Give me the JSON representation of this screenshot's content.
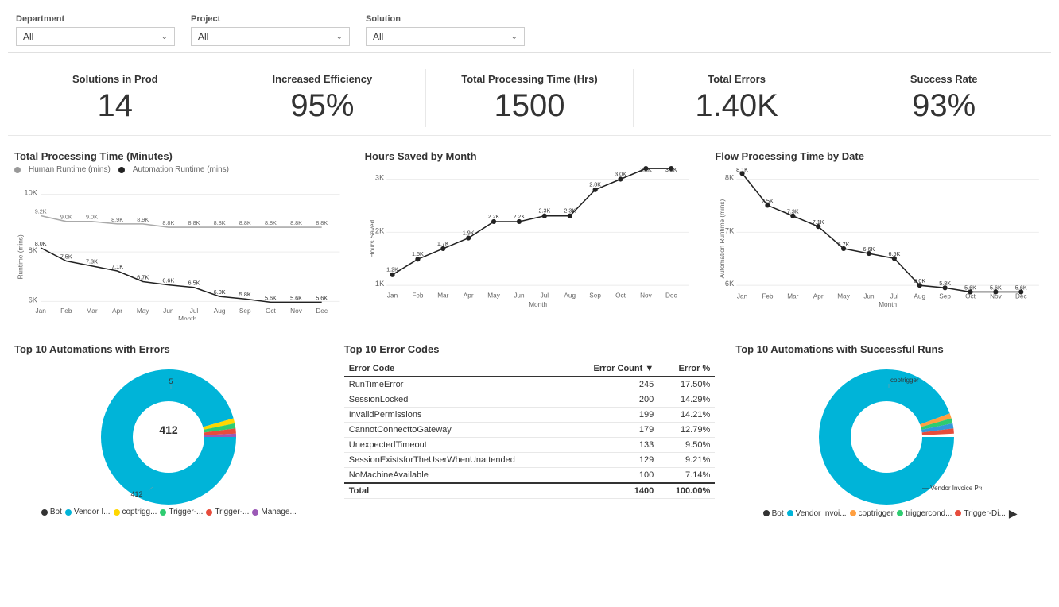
{
  "filters": {
    "department": {
      "label": "Department",
      "value": "All"
    },
    "project": {
      "label": "Project",
      "value": "All"
    },
    "solution": {
      "label": "Solution",
      "value": "All"
    }
  },
  "kpis": [
    {
      "label": "Solutions in Prod",
      "value": "14"
    },
    {
      "label": "Increased Efficiency",
      "value": "95%"
    },
    {
      "label": "Total Processing Time (Hrs)",
      "value": "1500"
    },
    {
      "label": "Total Errors",
      "value": "1.40K"
    },
    {
      "label": "Success Rate",
      "value": "93%"
    }
  ],
  "charts": {
    "processing_time": {
      "title": "Total Processing Time (Minutes)",
      "legend_human": "Human Runtime (mins)",
      "legend_auto": "Automation Runtime (mins)",
      "months": [
        "Jan",
        "Feb",
        "Mar",
        "Apr",
        "May",
        "Jun",
        "Jul",
        "Aug",
        "Sep",
        "Oct",
        "Nov",
        "Dec"
      ],
      "human": [
        9200,
        9000,
        9000,
        8900,
        8900,
        8800,
        8800,
        8800,
        8800,
        8800,
        8800,
        8800
      ],
      "automation": [
        8000,
        7500,
        7300,
        7100,
        6700,
        6600,
        6500,
        6000,
        5800,
        5600,
        5600,
        5600
      ]
    },
    "hours_saved": {
      "title": "Hours Saved by Month",
      "months": [
        "Jan",
        "Feb",
        "Mar",
        "Apr",
        "May",
        "Jun",
        "Jul",
        "Aug",
        "Sep",
        "Oct",
        "Nov",
        "Dec"
      ],
      "values": [
        1200,
        1500,
        1700,
        1900,
        2200,
        2200,
        2300,
        2300,
        2800,
        3000,
        3200,
        3200
      ]
    },
    "flow_processing": {
      "title": "Flow Processing Time by Date",
      "months": [
        "Jan",
        "Feb",
        "Mar",
        "Apr",
        "May",
        "Jun",
        "Jul",
        "Aug",
        "Sep",
        "Oct",
        "Nov",
        "Dec"
      ],
      "values": [
        8100,
        7500,
        7300,
        7100,
        6700,
        6600,
        6500,
        6000,
        5800,
        5600,
        5600,
        5600
      ]
    }
  },
  "top_errors": {
    "title": "Top 10 Automations with Errors",
    "donut_value": "412",
    "donut_top": "5",
    "colors": [
      "#00b4d8",
      "#ffd700",
      "#2ecc71",
      "#e74c3c",
      "#9b59b6"
    ],
    "legend": [
      "Bot",
      "Vendor I...",
      "coptrigg...",
      "Trigger-...",
      "Trigger-...",
      "Manage..."
    ]
  },
  "error_codes": {
    "title": "Top 10 Error Codes",
    "headers": [
      "Error Code",
      "Error Count",
      "Error %"
    ],
    "rows": [
      [
        "RunTimeError",
        "245",
        "17.50%"
      ],
      [
        "SessionLocked",
        "200",
        "14.29%"
      ],
      [
        "InvalidPermissions",
        "199",
        "14.21%"
      ],
      [
        "CannotConnecttoGateway",
        "179",
        "12.79%"
      ],
      [
        "UnexpectedTimeout",
        "133",
        "9.50%"
      ],
      [
        "SessionExistsforTheUserWhenUnattended",
        "129",
        "9.21%"
      ],
      [
        "NoMachineAvailable",
        "100",
        "7.14%"
      ]
    ],
    "total_row": [
      "Total",
      "1400",
      "100.00%"
    ]
  },
  "top_successful": {
    "title": "Top 10 Automations with Successful Runs",
    "label": "coptrigger",
    "label2": "— Vendor Invoice Processing Cl...",
    "colors": [
      "#00b4d8",
      "#ff9f40",
      "#2ecc71",
      "#3498db",
      "#e74c3c"
    ],
    "legend": [
      "Bot",
      "Vendor Invoi...",
      "coptrigger",
      "triggercond...",
      "Trigger-Di..."
    ]
  }
}
